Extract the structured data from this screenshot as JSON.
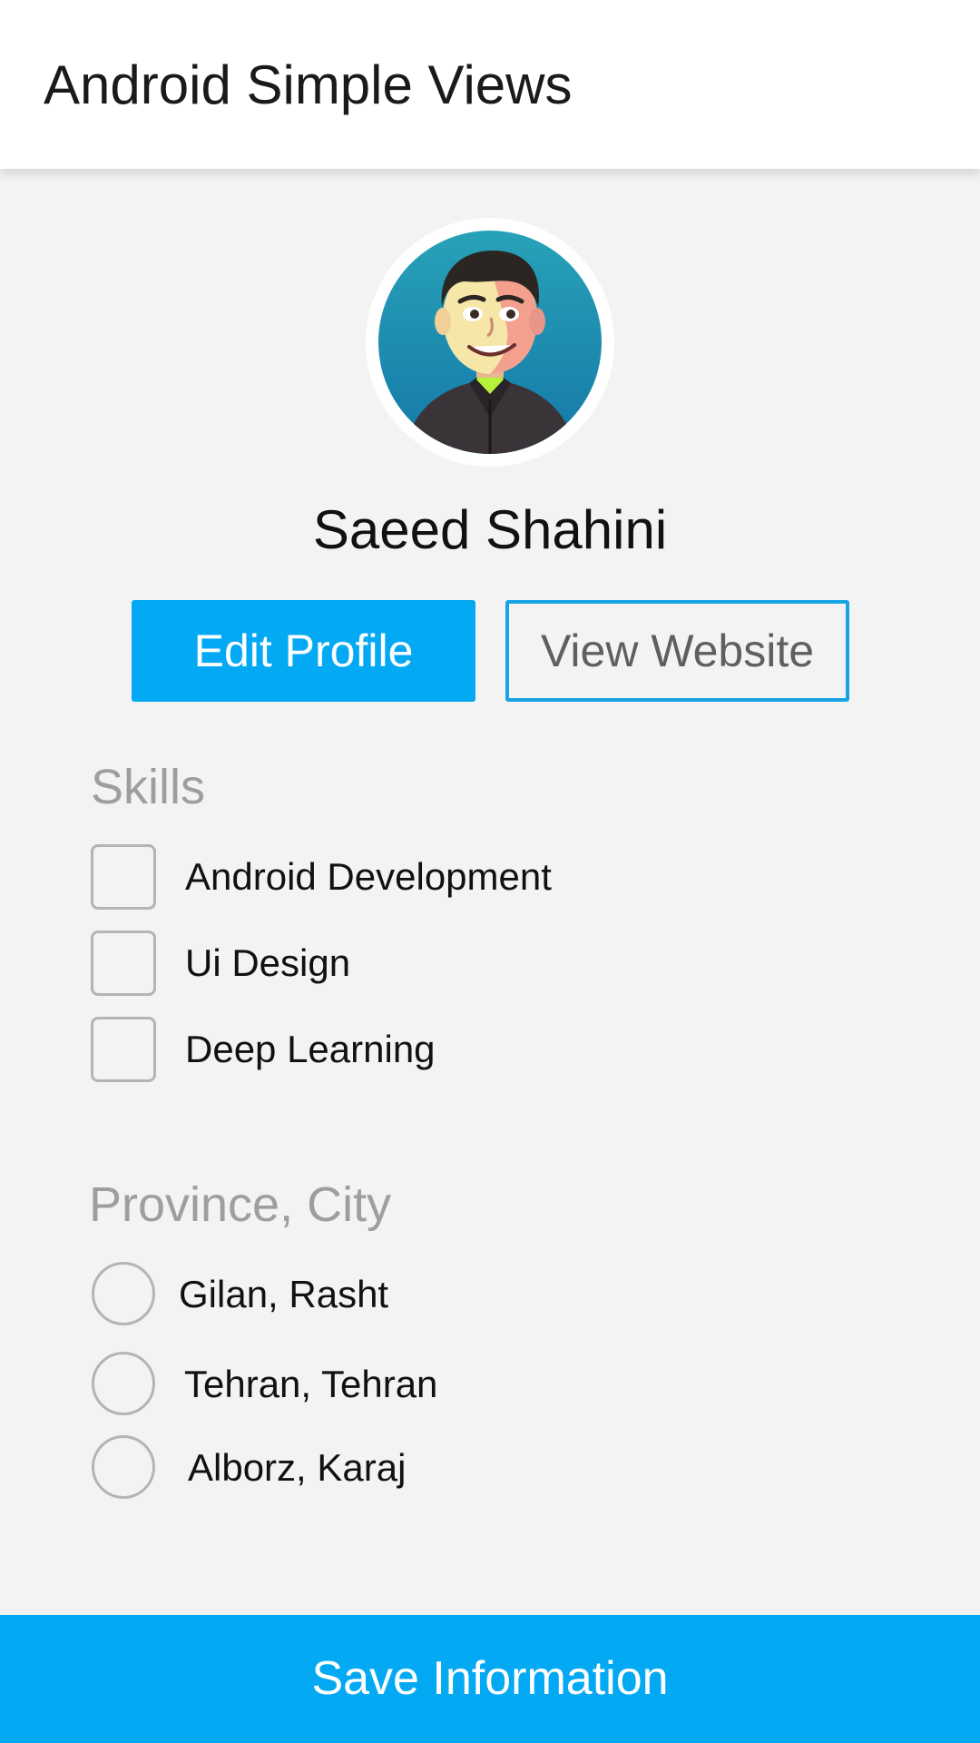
{
  "toolbar": {
    "title": "Android Simple Views"
  },
  "profile": {
    "avatar_icon": "cartoon-avatar",
    "name": "Saeed Shahini",
    "edit_button": "Edit Profile",
    "website_button": "View Website"
  },
  "skills": {
    "title": "Skills",
    "items": [
      {
        "label": "Android Development",
        "checked": false
      },
      {
        "label": "Ui Design",
        "checked": false
      },
      {
        "label": "Deep Learning",
        "checked": false
      }
    ]
  },
  "location": {
    "title": "Province, City",
    "options": [
      {
        "label": "Gilan, Rasht",
        "selected": false
      },
      {
        "label": "Tehran, Tehran",
        "selected": false
      },
      {
        "label": "Alborz, Karaj",
        "selected": false
      }
    ]
  },
  "save_button": "Save Information",
  "colors": {
    "accent": "#04a9f4",
    "toolbar_bg": "#ffffff",
    "page_bg": "#f3f3f3",
    "section_title": "#9e9e9e"
  }
}
